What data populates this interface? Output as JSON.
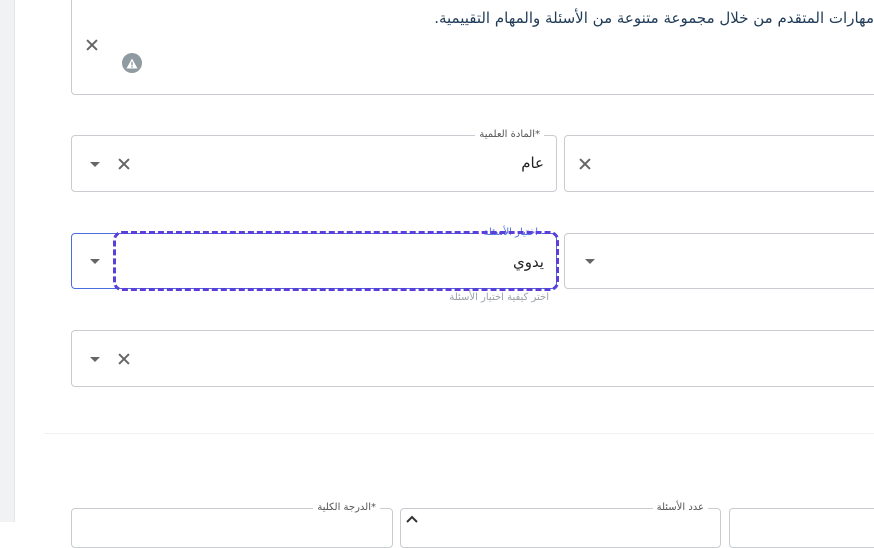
{
  "description": {
    "text": "مهارات المتقدم من خلال مجموعة متنوعة من الأسئلة والمهام التقييمية."
  },
  "subject_field": {
    "label": "المادة العلمية*",
    "value": "عام"
  },
  "question_selection_field": {
    "label": "اختيار الأسئلة",
    "value": "يدوي",
    "helper": "اختر كيفية اختيار الأسئلة"
  },
  "total_grade_field": {
    "label": "الدرجة الكلية*"
  },
  "question_count_field": {
    "label": "عدد الأسئلة"
  },
  "icons": {
    "clear": "close-icon",
    "dropdown": "caret-down-icon",
    "warning": "warning-triangle-icon",
    "stepper_up": "chevron-up-icon"
  },
  "colors": {
    "focus_ring": "#5b3fd8",
    "active_border": "#4a6ee0",
    "text": "#1f3b57"
  }
}
